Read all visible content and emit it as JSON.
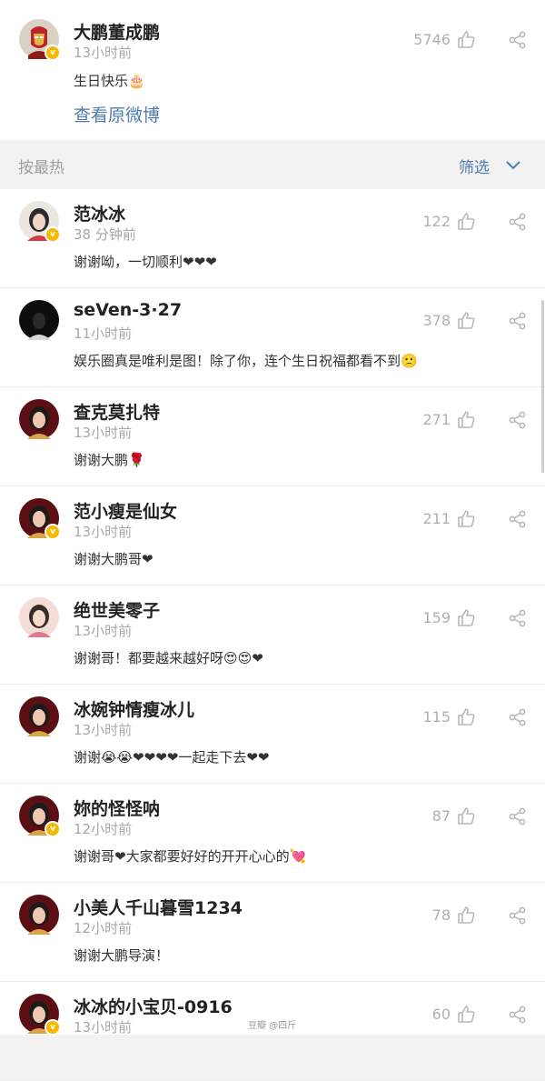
{
  "post": {
    "author": "大鹏董成鹏",
    "time": "13小时前",
    "text": "生日快乐🎂",
    "likes": "5746",
    "view_original": "查看原微博",
    "verified": true
  },
  "sortbar": {
    "sort_label": "按最热",
    "filter_label": "筛选"
  },
  "comments": [
    {
      "name": "范冰冰",
      "time": "38 分钟前",
      "text": "谢谢呦，一切顺利❤❤❤",
      "likes": "122",
      "verified": true
    },
    {
      "name": "seVen-3·27",
      "time": "11小时前",
      "text": "娱乐圈真是唯利是图！除了你，连个生日祝福都看不到🙁",
      "likes": "378",
      "verified": false
    },
    {
      "name": "查克莫扎特",
      "time": "13小时前",
      "text": "谢谢大鹏🌹",
      "likes": "271",
      "verified": false
    },
    {
      "name": "范小瘦是仙女",
      "time": "13小时前",
      "text": "谢谢大鹏哥❤",
      "likes": "211",
      "verified": true
    },
    {
      "name": "绝世美零子",
      "time": "13小时前",
      "text": "谢谢哥！都要越来越好呀😍😍❤",
      "likes": "159",
      "verified": false
    },
    {
      "name": "冰婉钟情瘦冰儿",
      "time": "13小时前",
      "text": "谢谢😭😭❤❤❤❤一起走下去❤❤",
      "likes": "115",
      "verified": false
    },
    {
      "name": "妳的怪怪呐",
      "time": "12小时前",
      "text": "谢谢哥❤大家都要好好的开开心心的💘",
      "likes": "87",
      "verified": true
    },
    {
      "name": "小美人千山暮雪1234",
      "time": "12小时前",
      "text": "谢谢大鹏导演！",
      "likes": "78",
      "verified": false
    },
    {
      "name": "冰冰的小宝贝-0916",
      "time": "13小时前",
      "text": "",
      "likes": "60",
      "verified": true
    }
  ],
  "watermark": "豆瓣  @四斤",
  "colors": {
    "link": "#4f7cae",
    "muted": "#a8a8a8",
    "verified_badge": "#f6b800",
    "heart": "#e8322f"
  }
}
